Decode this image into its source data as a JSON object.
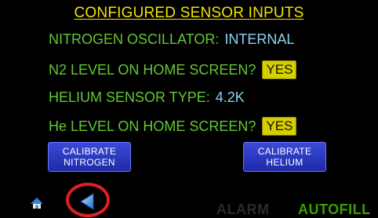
{
  "header": {
    "title": "CONFIGURED SENSOR INPUTS"
  },
  "settings": {
    "nitrogen_oscillator": {
      "label": "NITROGEN OSCILLATOR:",
      "value": "INTERNAL"
    },
    "n2_level_home": {
      "label": "N2 LEVEL ON HOME SCREEN?",
      "value": "YES"
    },
    "helium_sensor_type": {
      "label": "HELIUM SENSOR TYPE:",
      "value": "4.2K"
    },
    "he_level_home": {
      "label": "He LEVEL ON HOME SCREEN?",
      "value": "YES"
    }
  },
  "buttons": {
    "calibrate_nitrogen": {
      "line1": "CALIBRATE",
      "line2": "NITROGEN"
    },
    "calibrate_helium": {
      "line1": "CALIBRATE",
      "line2": "HELIUM"
    }
  },
  "footer": {
    "alarm": "ALARM",
    "autofill": "AUTOFILL"
  },
  "icons": {
    "home": "home-icon",
    "back": "back-arrow-icon"
  },
  "colors": {
    "background": "#000000",
    "title": "#f2e400",
    "label": "#63c833",
    "value": "#8ed2f4",
    "toggle": "#d6cf00",
    "button": "#2a37c4",
    "highlight_ring": "#e0201c",
    "autofill": "#39a000",
    "alarm_inactive": "#2b2b2b"
  }
}
